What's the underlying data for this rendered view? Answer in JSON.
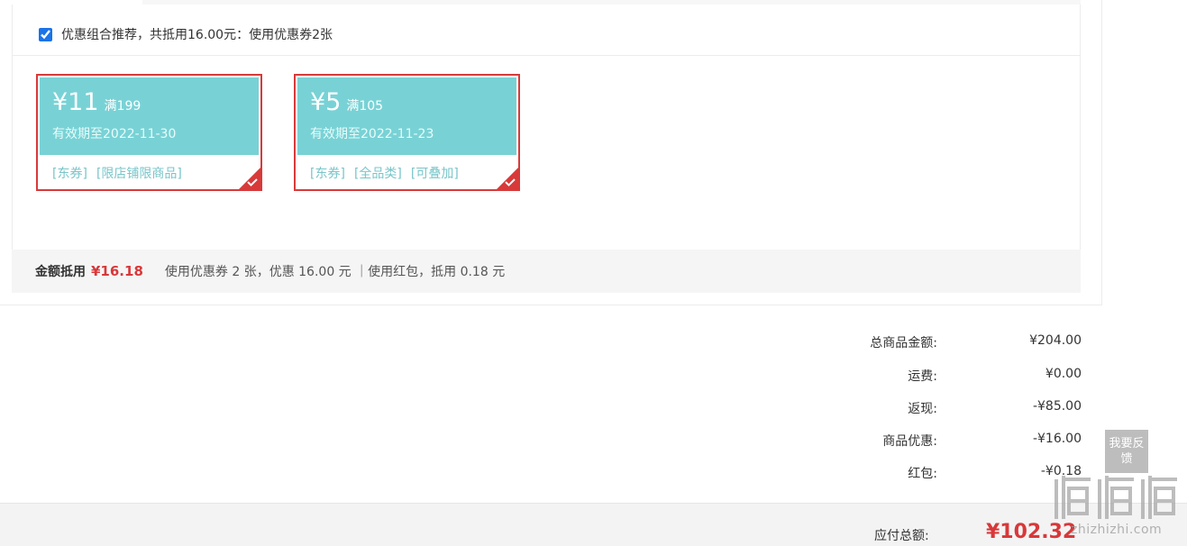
{
  "combo": {
    "checked": true,
    "text": "优惠组合推荐，共抵用16.00元：使用优惠券2张"
  },
  "coupons": [
    {
      "amount": "¥11",
      "condition": "满199",
      "valid": "有效期至2022-11-30",
      "tags": [
        "[东券]",
        "[限店铺限商品]"
      ],
      "selected": true
    },
    {
      "amount": "¥5",
      "condition": "满105",
      "valid": "有效期至2022-11-23",
      "tags": [
        "[东券]",
        "[全品类]",
        "[可叠加]"
      ],
      "selected": true
    }
  ],
  "summary": {
    "label": "金额抵用",
    "amount": "¥16.18",
    "detail": "使用优惠券 2 张，优惠 16.00 元 ｜使用红包，抵用 0.18 元"
  },
  "prices": [
    {
      "label": "总商品金额:",
      "value": "¥204.00"
    },
    {
      "label": "运费:",
      "value": "¥0.00"
    },
    {
      "label": "返现:",
      "value": "-¥85.00"
    },
    {
      "label": "商品优惠:",
      "value": "-¥16.00"
    },
    {
      "label": "红包:",
      "value": "-¥0.18"
    }
  ],
  "total": {
    "label": "应付总额:",
    "amount": "¥102.32"
  },
  "feedback": {
    "label": "我要反馈"
  },
  "watermark": {
    "site": "zhizhizhi.com"
  },
  "colors": {
    "coupon_face": "#78d2d5",
    "accent_red": "#d8383a",
    "tag_text": "#78c5c9"
  }
}
